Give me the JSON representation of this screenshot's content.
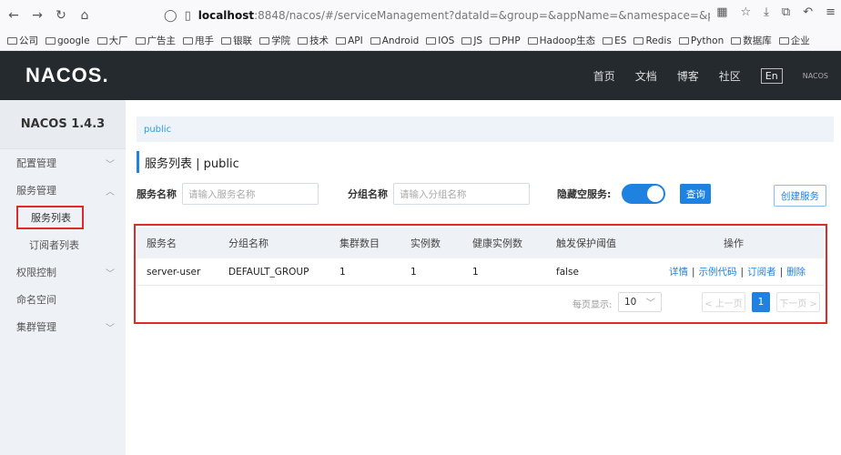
{
  "browser": {
    "url_host": "localhost",
    "url_rest": ":8848/nacos/#/serviceManagement?dataId=&group=&appName=&namespace=&p",
    "bookmarks": [
      "公司",
      "google",
      "大厂",
      "广告主",
      "甩手",
      "银联",
      "学院",
      "技术",
      "API",
      "Android",
      "IOS",
      "JS",
      "PHP",
      "Hadoop生态",
      "ES",
      "Redis",
      "Python",
      "数据库",
      "企业"
    ]
  },
  "header": {
    "logo": "NACOS.",
    "nav": [
      "首页",
      "文档",
      "博客",
      "社区"
    ],
    "lang": "En",
    "extra": "NACOS"
  },
  "sidebar": {
    "version": "NACOS 1.4.3",
    "items": [
      {
        "label": "配置管理",
        "arrow": "﹀"
      },
      {
        "label": "服务管理",
        "arrow": "︿"
      },
      {
        "label": "服务列表",
        "sub": true,
        "active": true
      },
      {
        "label": "订阅者列表",
        "sub": true
      },
      {
        "label": "权限控制",
        "arrow": "﹀"
      },
      {
        "label": "命名空间",
        "arrow": ""
      },
      {
        "label": "集群管理",
        "arrow": "﹀"
      }
    ]
  },
  "main": {
    "breadcrumb": "public",
    "title": "服务列表  |  public",
    "filters": {
      "service_label": "服务名称",
      "service_placeholder": "请输入服务名称",
      "group_label": "分组名称",
      "group_placeholder": "请输入分组名称",
      "hide_empty_label": "隐藏空服务:",
      "query_button": "查询",
      "create_button": "创建服务"
    },
    "table": {
      "headers": [
        "服务名",
        "分组名称",
        "集群数目",
        "实例数",
        "健康实例数",
        "触发保护阈值",
        "操作"
      ],
      "rows": [
        {
          "name": "server-user",
          "group": "DEFAULT_GROUP",
          "clusters": "1",
          "instances": "1",
          "healthy": "1",
          "threshold": "false",
          "actions": [
            "详情",
            "示例代码",
            "订阅者",
            "删除"
          ]
        }
      ]
    },
    "pager": {
      "label": "每页显示:",
      "page_size": "10",
      "prev": "< 上一页",
      "current": "1",
      "next": "下一页 >"
    }
  },
  "colors": {
    "accent": "#1f82e0",
    "header_bg": "#252a2f",
    "highlight": "#e02a2a"
  }
}
